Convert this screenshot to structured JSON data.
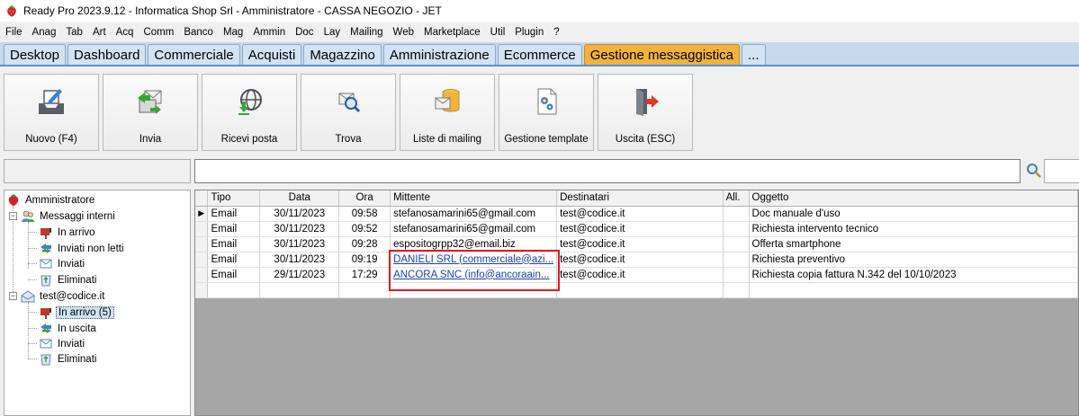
{
  "window": {
    "title": "Ready Pro 2023.9.12 - Informatica Shop Srl - Amministratore - CASSA NEGOZIO - JET"
  },
  "menu": [
    "File",
    "Anag",
    "Tab",
    "Art",
    "Acq",
    "Comm",
    "Banco",
    "Mag",
    "Ammin",
    "Doc",
    "Lay",
    "Mailing",
    "Web",
    "Marketplace",
    "Util",
    "Plugin",
    "?"
  ],
  "tabs": [
    "Desktop",
    "Dashboard",
    "Commerciale",
    "Acquisti",
    "Magazzino",
    "Amministrazione",
    "Ecommerce",
    "Gestione messaggistica",
    "..."
  ],
  "active_tab": "Gestione messaggistica",
  "toolbar": {
    "new_label": "Nuovo (F4)",
    "send_label": "Invia",
    "receive_label": "Ricevi posta",
    "find_label": "Trova",
    "mailing_lists_label": "Liste di mailing",
    "templates_label": "Gestione template",
    "exit_label": "Uscita (ESC)"
  },
  "search": {
    "value": ""
  },
  "tree": {
    "root": "Amministratore",
    "internal": {
      "label": "Messaggi interni",
      "items": [
        "In arrivo",
        "Inviati non letti",
        "Inviati",
        "Eliminati"
      ]
    },
    "account": {
      "label": "test@codice.it",
      "items": [
        "In arrivo (5)",
        "In uscita",
        "Inviati",
        "Eliminati"
      ]
    }
  },
  "grid": {
    "columns": [
      "Tipo",
      "Data",
      "Ora",
      "Mittente",
      "Destinatari",
      "All.",
      "Oggetto"
    ],
    "rows": [
      [
        "Email",
        "30/11/2023",
        "09:58",
        "stefanosamarini65@gmail.com",
        "test@codice.it",
        "",
        "Doc manuale d'uso"
      ],
      [
        "Email",
        "30/11/2023",
        "09:52",
        "stefanosamarini65@gmail.com",
        "test@codice.it",
        "",
        "Richiesta intervento tecnico"
      ],
      [
        "Email",
        "30/11/2023",
        "09:28",
        "espositogrpp32@email.biz",
        "test@codice.it",
        "",
        "Offerta smartphone"
      ],
      [
        "Email",
        "30/11/2023",
        "09:19",
        "DANIELI SRL (commerciale@azi...",
        "test@codice.it",
        "",
        "Richiesta preventivo"
      ],
      [
        "Email",
        "29/11/2023",
        "17:29",
        "ANCORA SNC (info@ancoraain...",
        "test@codice.it",
        "",
        "Richiesta copia fattura N.342 del 10/10/2023"
      ]
    ]
  },
  "colors": {
    "active_tab": "#f3b23c",
    "tab_strip": "#c7d8ea",
    "highlight": "#e01b24",
    "link": "#1a3fb0"
  }
}
